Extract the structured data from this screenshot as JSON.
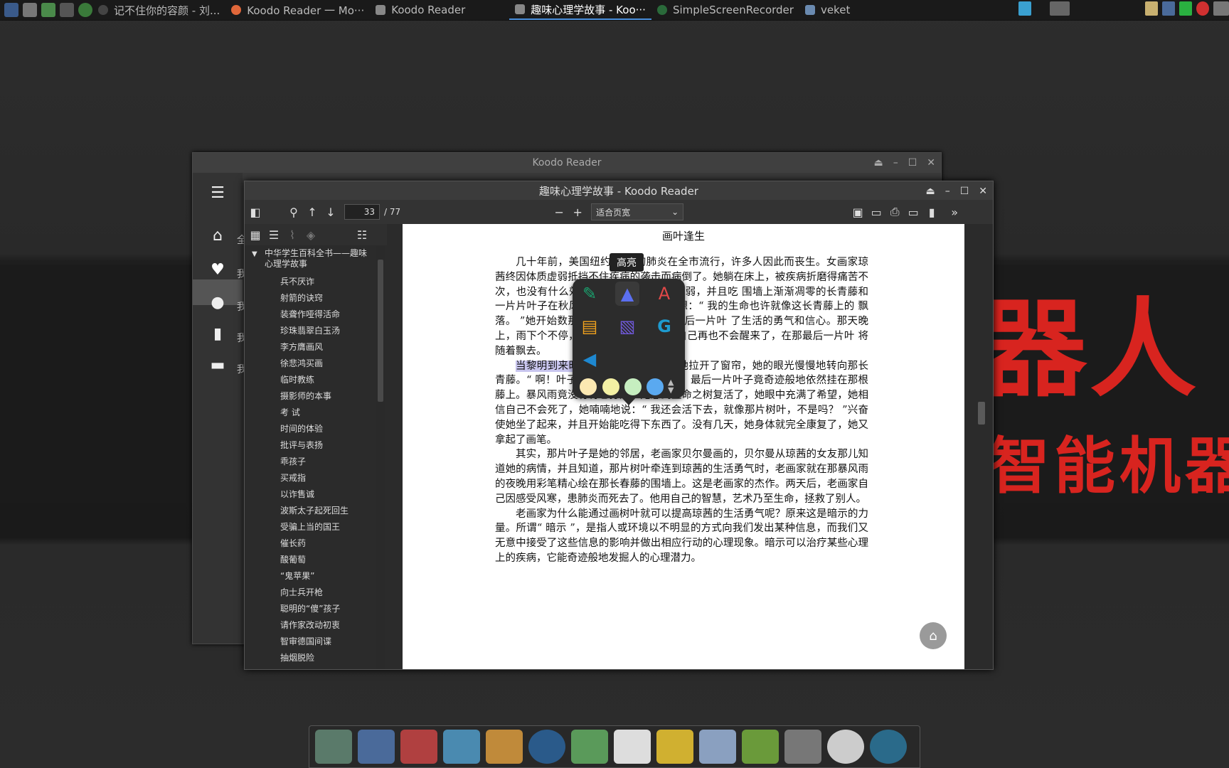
{
  "taskbar": {
    "tasks": [
      {
        "label": "记不住你的容颜 - 刘...",
        "active": false
      },
      {
        "label": "Koodo Reader 一 Mo···",
        "active": false
      },
      {
        "label": "Koodo Reader",
        "active": false
      },
      {
        "label": "趣味心理学故事 - Koo···",
        "active": true
      },
      {
        "label": "SimpleScreenRecorder",
        "active": false
      },
      {
        "label": "veket",
        "active": false
      }
    ]
  },
  "wallpaper": {
    "text1": "器人",
    "text2": "智能机器"
  },
  "back_window": {
    "title": "Koodo Reader",
    "side_labels": [
      "全",
      "我",
      "我",
      "我",
      "我"
    ]
  },
  "front_window": {
    "title": "趣味心理学故事 - Koodo Reader",
    "toolbar": {
      "page_current": "33",
      "page_total": "/ 77",
      "zoom_mode": "适合页宽"
    }
  },
  "toc": {
    "root": "中华学生百科全书——趣味心理学故事",
    "items": [
      "兵不厌诈",
      "射箭的诀窍",
      "装聋作哑得活命",
      "珍珠翡翠白玉汤",
      "李方膺画风",
      "徐悲鸿买画",
      "临时教练",
      "摄影师的本事",
      "考 试",
      "时间的体验",
      "批评与表扬",
      "乖孩子",
      "买戒指",
      "以诈售诚",
      "波斯太子起死回生",
      "受骗上当的国王",
      "催长药",
      "酸葡萄",
      "“鬼苹果”",
      "向士兵开枪",
      "聪明的“傻”孩子",
      "请作家改动初衷",
      "智审德国间谍",
      "抽烟脱险"
    ]
  },
  "page": {
    "title": "画叶逢生",
    "p1": "几十年前，美国纽约 可怕的肺炎在全市流行，许多人因此而丧生。女画家琼茜终因体质虚弱抵挡不住疾病的袭击而病倒了。她躺在床上，被疾病折磨得痛苦不 次，也没有什么效果，她只觉得越来越虚弱，并且吃 围墙上渐渐凋零的长青藤和一片片叶子在秋风中飘落 笼罩了她。她想：“ 我的生命也许就像这长青藤上的 飘落。 ”她开始数那剩下的叶子，当还剩最后一片叶 了生活的勇气和信心。那天晚上，雨下个不停，风刮 渐睡去，她觉得自己再也不会醒来了，在那最后一片叶 将随着飘去。",
    "p2_highlight": "当黎明到来时",
    "p2": " 她醒了。她的女友为她拉开了窗帘，她的眼光慢慢地转向那长青藤。“ 啊！叶子！ ”她惊异地喊了出来，最后一片叶子竟奇迹般地依然挂在那根藤上。暴风雨竟没有将它打落。她感到生命之树复活了，她眼中充满了希望，她相信自己不会死了，她喃喃地说：“ 我还会活下去，就像那片树叶，不是吗？ ”兴奋使她坐了起来，并且开始能吃得下东西了。没有几天，她身体就完全康复了，她又拿起了画笔。",
    "p3": "其实，那片叶子是她的邻居，老画家贝尔曼画的，贝尔曼从琼茜的女友那儿知道她的病情，并且知道，那片树叶牵连到琼茜的生活勇气时，老画家就在那暴风雨的夜晚用彩笔精心绘在那长春藤的围墙上。这是老画家的杰作。两天后，老画家自己因感受风寒，患肺炎而死去了。他用自己的智慧，艺术乃至生命，拯救了别人。",
    "p4": "老画家为什么能通过画树叶就可以提高琼茜的生活勇气呢？原来这是暗示的力量。所谓“ 暗示 ”，是指人或环境以不明显的方式向我们发出某种信息，而我们又无意中接受了这些信息的影响并做出相应行动的心理现象。暗示可以治疗某些心理上的疾病，它能奇迹般地发掘人的心理潜力。"
  },
  "popup": {
    "tooltip": "高亮",
    "colors": {
      "note": "#1aa36f",
      "highlight": "#5b6ff0",
      "translate": "#e04848",
      "copy": "#f0a21e",
      "search": "#6f58d8",
      "google": "#1e9bd0",
      "speak": "#1e88d0"
    },
    "swatches": [
      "#fce8b2",
      "#f3f0a4",
      "#c6eec0",
      "#5aa9f0"
    ]
  }
}
